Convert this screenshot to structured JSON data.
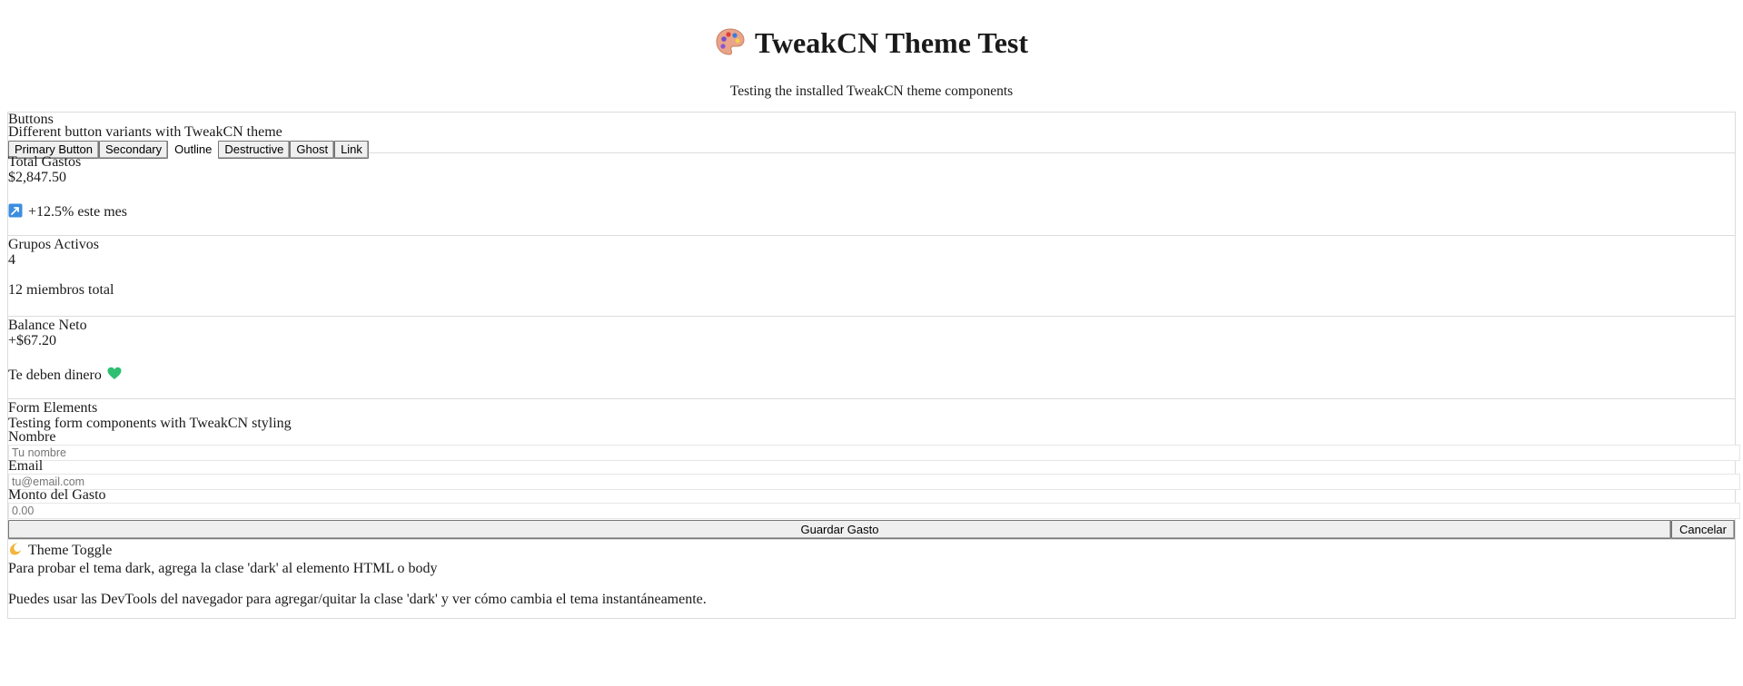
{
  "header": {
    "title": "TweakCN Theme Test",
    "title_icon": "palette-icon",
    "subtitle": "Testing the installed TweakCN theme components"
  },
  "buttons_card": {
    "title": "Buttons",
    "description": "Different button variants with TweakCN theme",
    "buttons": {
      "primary": "Primary Button",
      "secondary": "Secondary",
      "outline": "Outline",
      "destructive": "Destructive",
      "ghost": "Ghost",
      "link": "Link"
    }
  },
  "stats": {
    "total_gastos": {
      "label": "Total Gastos",
      "value": "$2,847.50",
      "trend_icon": "trend-up-icon",
      "note": "+12.5% este mes"
    },
    "grupos_activos": {
      "label": "Grupos Activos",
      "value": "4",
      "note": "12 miembros total"
    },
    "balance_neto": {
      "label": "Balance Neto",
      "value": "+$67.20",
      "note": "Te deben dinero",
      "note_icon": "green-heart-icon"
    }
  },
  "form": {
    "title": "Form Elements",
    "description": "Testing form components with TweakCN styling",
    "fields": {
      "name": {
        "label": "Nombre",
        "placeholder": "Tu nombre",
        "value": ""
      },
      "email": {
        "label": "Email",
        "placeholder": "tu@email.com",
        "value": ""
      },
      "amount": {
        "label": "Monto del Gasto",
        "placeholder": "0.00",
        "value": ""
      }
    },
    "save_label": "Guardar Gasto",
    "cancel_label": "Cancelar"
  },
  "theme_toggle": {
    "icon": "crescent-moon-icon",
    "title": "Theme Toggle",
    "line1": "Para probar el tema dark, agrega la clase 'dark' al elemento HTML o body",
    "line2": "Puedes usar las DevTools del navegador para agregar/quitar la clase 'dark' y ver cómo cambia el tema instantáneamente."
  },
  "colors": {
    "border": "#dcdcdc",
    "button_bg": "#efefef",
    "trend_icon_bg": "#3b8de0",
    "heart": "#2fbf71",
    "moon": "#f2b53a",
    "palette": "#e9a48a"
  }
}
